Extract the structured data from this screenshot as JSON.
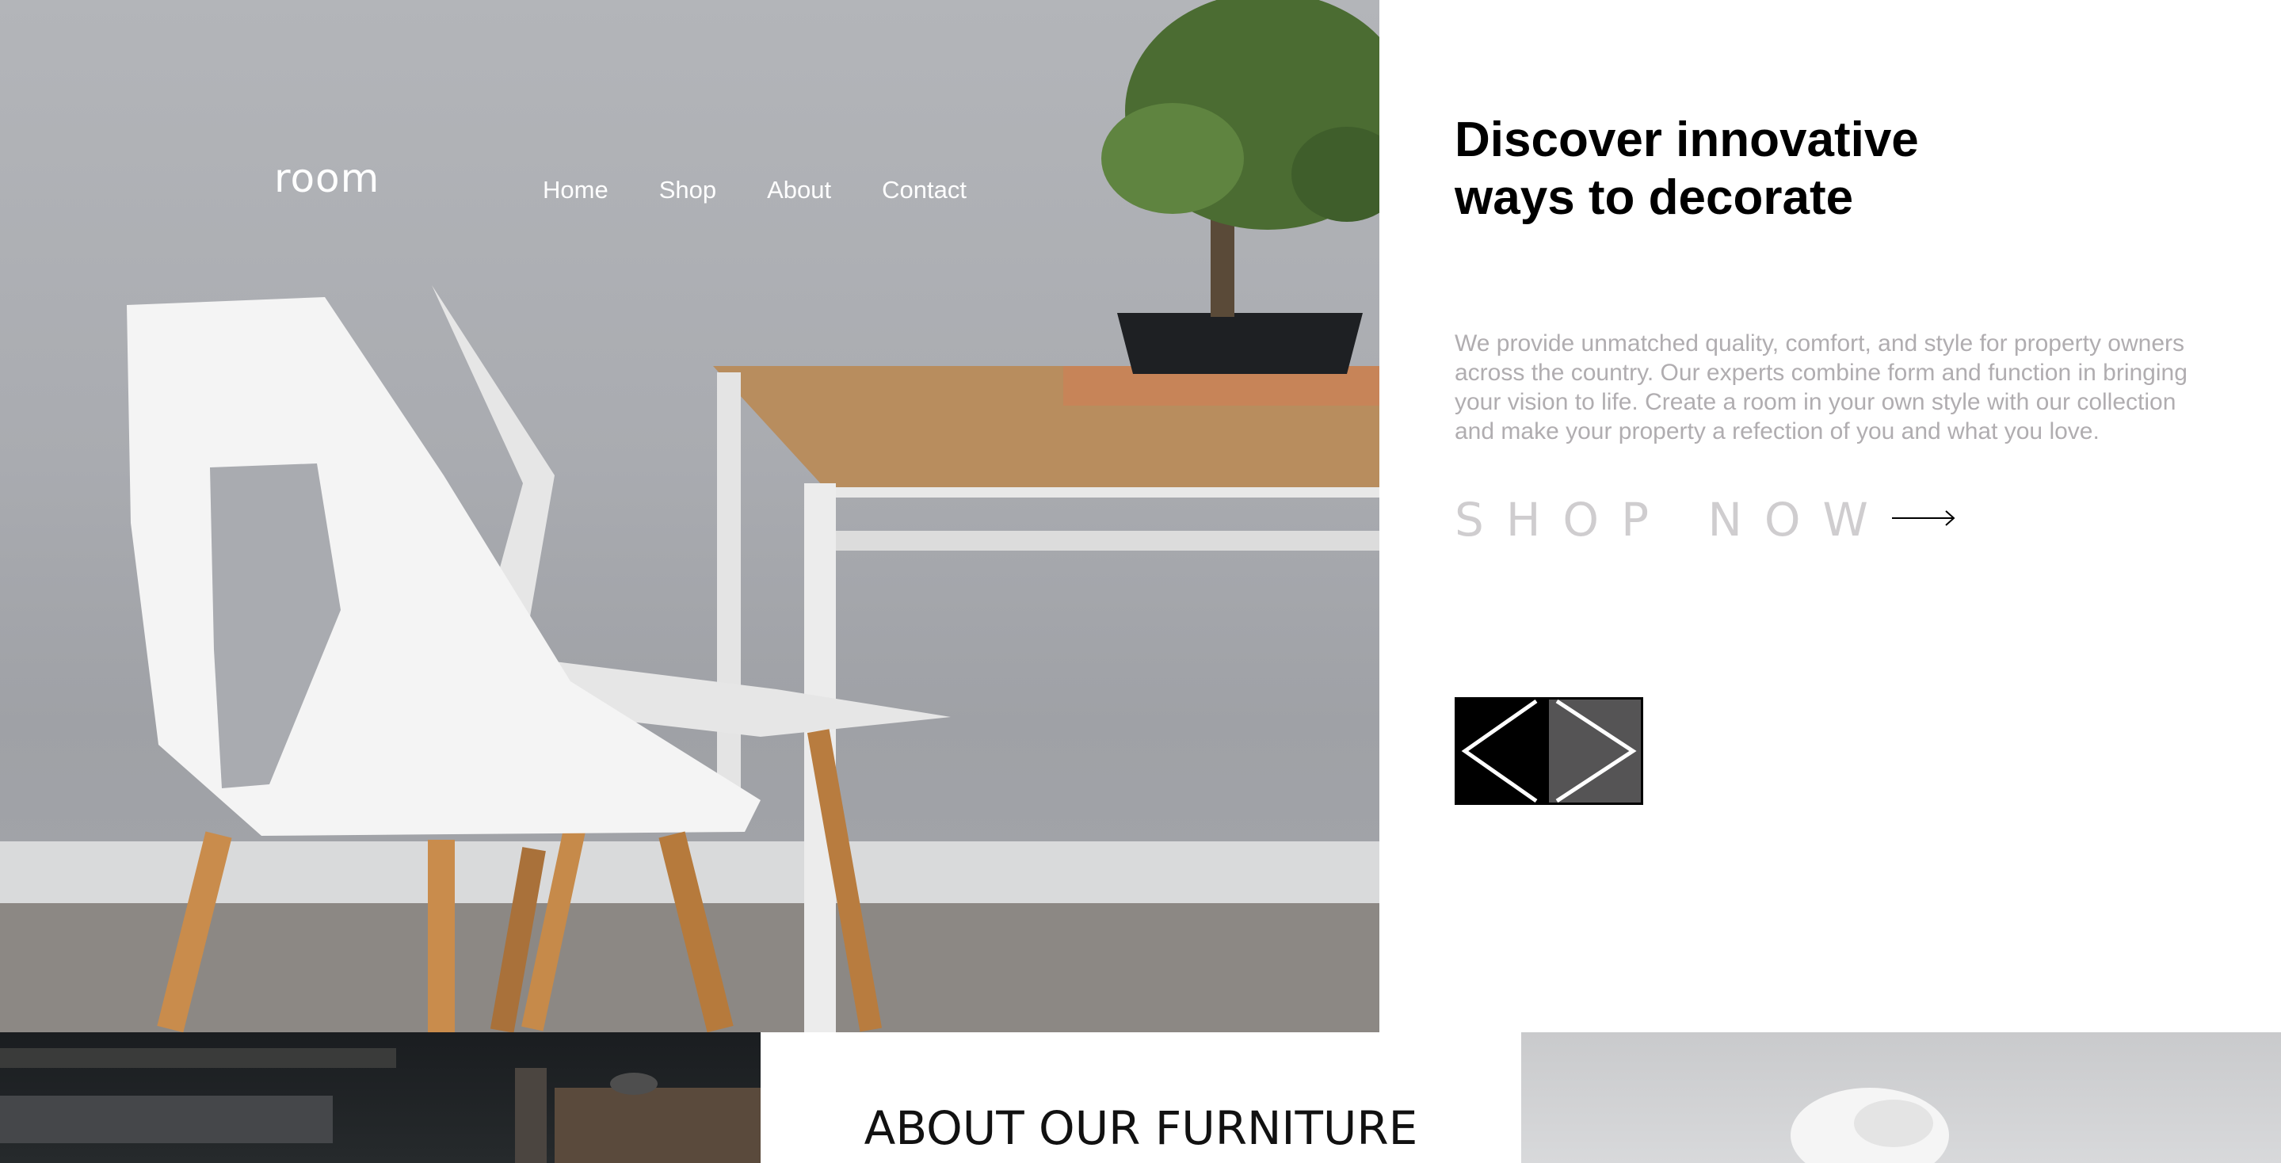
{
  "brand": {
    "logo_text": "room"
  },
  "nav": {
    "items": [
      {
        "label": "Home"
      },
      {
        "label": "Shop"
      },
      {
        "label": "About"
      },
      {
        "label": "Contact"
      }
    ]
  },
  "hero": {
    "headline_line1": "Discover innovative",
    "headline_line2": "ways to decorate",
    "description": "We provide unmatched quality, comfort, and style for property owners across the country. Our experts combine form and function in bringing your vision to life. Create a room in your own style with our collection and make your property a refection of you and what you love.",
    "cta_label": "SHOP NOW",
    "cta_icon": "arrow-right-icon",
    "slider": {
      "prev_icon": "chevron-left-icon",
      "next_icon": "chevron-right-icon"
    }
  },
  "about": {
    "heading": "ABOUT OUR FURNITURE"
  },
  "colors": {
    "headline": "#000000",
    "description": "#b0adb0",
    "cta": "#cfcdcf",
    "slider_prev_bg": "#000000",
    "slider_next_bg": "#555455"
  }
}
